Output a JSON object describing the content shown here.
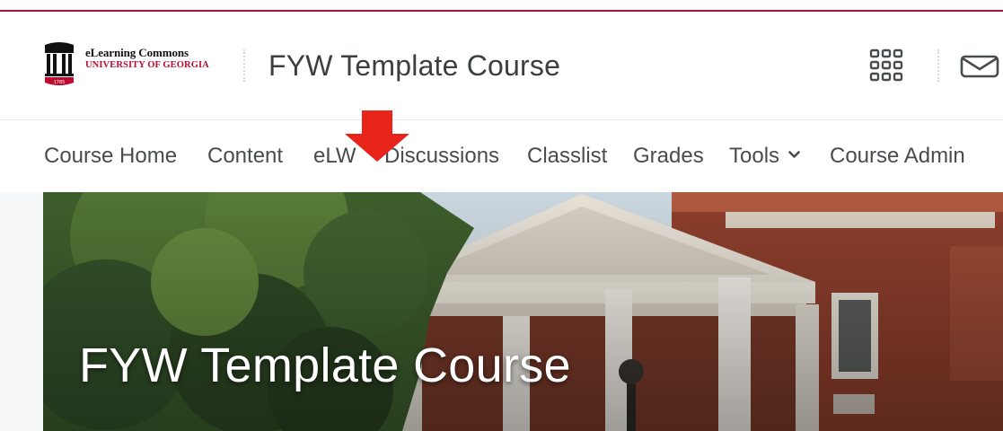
{
  "brand": {
    "line1": "eLearning Commons",
    "line2": "UNIVERSITY OF GEORGIA",
    "seal_year": "1785"
  },
  "header": {
    "course_title": "FYW Template Course",
    "icons": [
      "waffle-grid-icon",
      "envelope-icon"
    ]
  },
  "navbar": {
    "items": [
      {
        "label": "Course Home"
      },
      {
        "label": "Content"
      },
      {
        "label": "eLW"
      },
      {
        "label": "Discussions"
      },
      {
        "label": "Classlist"
      },
      {
        "label": "Grades"
      },
      {
        "label": "Tools",
        "has_dropdown": true
      },
      {
        "label": "Course Admin"
      }
    ]
  },
  "hero": {
    "title": "FYW Template Course"
  },
  "colors": {
    "brand_red": "#ba0c2f",
    "annotation_arrow": "#e8231a",
    "nav_text": "#494c4e"
  }
}
